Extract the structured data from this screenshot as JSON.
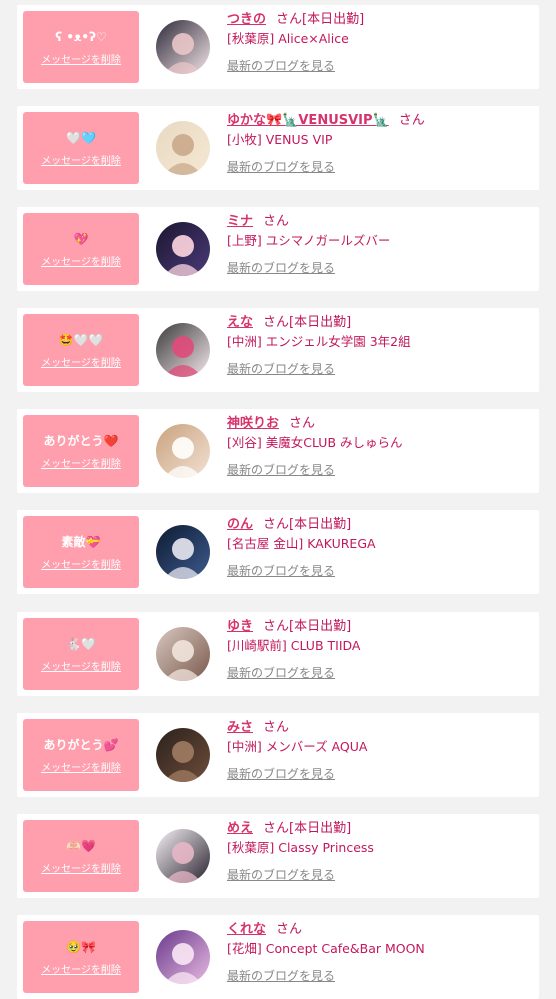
{
  "items": [
    {
      "message": "ʕ •ᴥ•ʔ♡",
      "delete_label": "メッセージを削除",
      "name": "つきの",
      "san": "さん",
      "status": "[本日出勤]",
      "shop": "[秋葉原] Alice×Alice",
      "blog_label": "最新のブログを見る",
      "avatar_colors": [
        "#2d2a3a",
        "#f3e3e6",
        "#e9c6c8"
      ]
    },
    {
      "message": "🤍🩵",
      "delete_label": "メッセージを削除",
      "name": "ゆかな🎀🗽VENUSVIP🗽",
      "san": "さん",
      "status": "",
      "shop": "[小牧] VENUS VIP",
      "blog_label": "最新のブログを見る",
      "avatar_colors": [
        "#e8d9c3",
        "#f5e8d2",
        "#c9a98b"
      ]
    },
    {
      "message": "💖",
      "delete_label": "メッセージを削除",
      "name": "ミナ",
      "san": "さん",
      "status": "",
      "shop": "[上野] ユシマノガールズバー",
      "blog_label": "最新のブログを見る",
      "avatar_colors": [
        "#1c1630",
        "#4a3a78",
        "#ffd6e0"
      ]
    },
    {
      "message": "🤩🤍🤍",
      "delete_label": "メッセージを削除",
      "name": "えな",
      "san": "さん",
      "status": "[本日出勤]",
      "shop": "[中洲] エンジェル女学園 3年2組",
      "blog_label": "最新のブログを見る",
      "avatar_colors": [
        "#3b3b3b",
        "#f4e6ea",
        "#e04a7a"
      ]
    },
    {
      "message": "ありがとう❤️",
      "delete_label": "メッセージを削除",
      "name": "神咲りお",
      "san": "さん",
      "status": "",
      "shop": "[刈谷] 美魔女CLUB みしゅらん",
      "blog_label": "最新のブログを見る",
      "avatar_colors": [
        "#c9a27e",
        "#f2e1d3",
        "#ffffff"
      ]
    },
    {
      "message": "素敵💝",
      "delete_label": "メッセージを削除",
      "name": "のん",
      "san": "さん",
      "status": "[本日出勤]",
      "shop": "[名古屋 金山] KAKUREGA",
      "blog_label": "最新のブログを見る",
      "avatar_colors": [
        "#0e1b33",
        "#3d5a8c",
        "#e8e8f0"
      ]
    },
    {
      "message": "🐇🤍",
      "delete_label": "メッセージを削除",
      "name": "ゆき",
      "san": "さん",
      "status": "[本日出勤]",
      "shop": "[川崎駅前] CLUB TIIDA",
      "blog_label": "最新のブログを見る",
      "avatar_colors": [
        "#d8c7c0",
        "#7a5a4c",
        "#f2e4dc"
      ]
    },
    {
      "message": "ありがとう💕",
      "delete_label": "メッセージを削除",
      "name": "みさ",
      "san": "さん",
      "status": "",
      "shop": "[中洲] メンバーズ AQUA",
      "blog_label": "最新のブログを見る",
      "avatar_colors": [
        "#2b211c",
        "#6d4c3a",
        "#a07c62"
      ]
    },
    {
      "message": "🫶🏻💗",
      "delete_label": "メッセージを削除",
      "name": "めえ",
      "san": "さん",
      "status": "[本日出勤]",
      "shop": "[秋葉原] Classy Princess",
      "blog_label": "最新のブログを見る",
      "avatar_colors": [
        "#f7f2f5",
        "#2a2330",
        "#e7b7c6"
      ]
    },
    {
      "message": "🥹🎀",
      "delete_label": "メッセージを削除",
      "name": "くれな",
      "san": "さん",
      "status": "",
      "shop": "[花畑] Concept Cafe&Bar MOON",
      "blog_label": "最新のブログを見る",
      "avatar_colors": [
        "#6a3a8c",
        "#e7b9e0",
        "#f9e7f4"
      ]
    }
  ]
}
